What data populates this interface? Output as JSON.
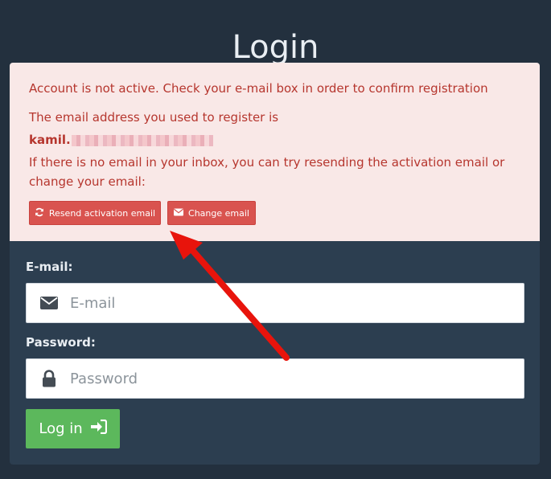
{
  "title": "Login",
  "alert": {
    "line1": "Account is not active. Check your e-mail box in order to confirm registration",
    "line2": "The email address you used to register is",
    "email_prefix": "kamil.",
    "line4": "If there is no email in your inbox, you can try resending the activation email or change your email:",
    "resend_label": "Resend activation email",
    "change_label": "Change email",
    "text_color": "#b6362e",
    "bg_color": "#f9e8e7"
  },
  "form": {
    "email_label": "E-mail:",
    "email_placeholder": "E-mail",
    "password_label": "Password:",
    "password_placeholder": "Password",
    "login_label": "Log in",
    "login_color": "#5cb85c"
  },
  "annotation": {
    "arrow_color": "#e8140c"
  },
  "icons": {
    "resend": "refresh-icon",
    "change": "envelope-icon",
    "email_field": "envelope-icon",
    "password_field": "lock-icon",
    "login": "sign-in-icon"
  }
}
